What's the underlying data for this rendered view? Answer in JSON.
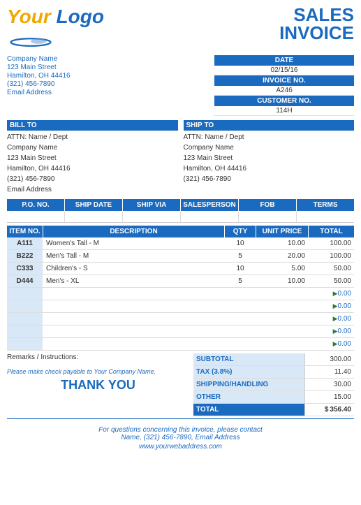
{
  "header": {
    "logo_text": "Your Logo",
    "title_line1": "SALES",
    "title_line2": "INVOICE"
  },
  "sender": {
    "company": "Company Name",
    "address1": "123 Main Street",
    "address2": "Hamilton, OH  44416",
    "phone": "(321) 456-7890",
    "email": "Email Address"
  },
  "invoice_meta": {
    "date_label": "DATE",
    "date_value": "02/15/16",
    "invoice_no_label": "INVOICE NO.",
    "invoice_no_value": "A246",
    "customer_no_label": "CUSTOMER NO.",
    "customer_no_value": "114H"
  },
  "bill_to": {
    "header": "BILL TO",
    "attn": "ATTN: Name / Dept",
    "company": "Company Name",
    "address1": "123 Main Street",
    "address2": "Hamilton, OH  44416",
    "phone": "(321) 456-7890",
    "email": "Email Address"
  },
  "ship_to": {
    "header": "SHIP TO",
    "attn": "ATTN: Name / Dept",
    "company": "Company Name",
    "address1": "123 Main Street",
    "address2": "Hamilton, OH  44416",
    "phone": "(321) 456-7890"
  },
  "po_row": {
    "headers": [
      "P.O. NO.",
      "SHIP DATE",
      "SHIP VIA",
      "SALESPERSON",
      "FOB",
      "TERMS"
    ],
    "values": [
      "",
      "",
      "",
      "",
      "",
      ""
    ]
  },
  "items_table": {
    "headers": [
      "ITEM NO.",
      "DESCRIPTION",
      "QTY",
      "UNIT PRICE",
      "TOTAL"
    ],
    "rows": [
      {
        "item": "A111",
        "desc": "Women's Tall - M",
        "qty": "10",
        "price": "10.00",
        "total": "100.00",
        "zero": false
      },
      {
        "item": "B222",
        "desc": "Men's Tall - M",
        "qty": "5",
        "price": "20.00",
        "total": "100.00",
        "zero": false
      },
      {
        "item": "C333",
        "desc": "Children's - S",
        "qty": "10",
        "price": "5.00",
        "total": "50.00",
        "zero": false
      },
      {
        "item": "D444",
        "desc": "Men's - XL",
        "qty": "5",
        "price": "10.00",
        "total": "50.00",
        "zero": false
      },
      {
        "item": "",
        "desc": "",
        "qty": "",
        "price": "",
        "total": "0.00",
        "zero": true
      },
      {
        "item": "",
        "desc": "",
        "qty": "",
        "price": "",
        "total": "0.00",
        "zero": true
      },
      {
        "item": "",
        "desc": "",
        "qty": "",
        "price": "",
        "total": "0.00",
        "zero": true
      },
      {
        "item": "",
        "desc": "",
        "qty": "",
        "price": "",
        "total": "0.00",
        "zero": true
      },
      {
        "item": "",
        "desc": "",
        "qty": "",
        "price": "",
        "total": "0.00",
        "zero": true
      }
    ]
  },
  "remarks_label": "Remarks / Instructions:",
  "check_payable": "Please make check payable to Your Company Name.",
  "thank_you": "THANK YOU",
  "totals": {
    "subtotal_label": "SUBTOTAL",
    "subtotal_value": "300.00",
    "tax_label": "TAX (3.8%)",
    "tax_value": "11.40",
    "shipping_label": "SHIPPING/HANDLING",
    "shipping_value": "30.00",
    "other_label": "OTHER",
    "other_value": "15.00",
    "total_label": "TOTAL",
    "total_dollar": "$",
    "total_value": "356.40"
  },
  "footer": {
    "line1": "For questions concerning this invoice, please contact",
    "line2": "Name, (321) 456-7890, Email Address",
    "website": "www.yourwebaddress.com"
  }
}
